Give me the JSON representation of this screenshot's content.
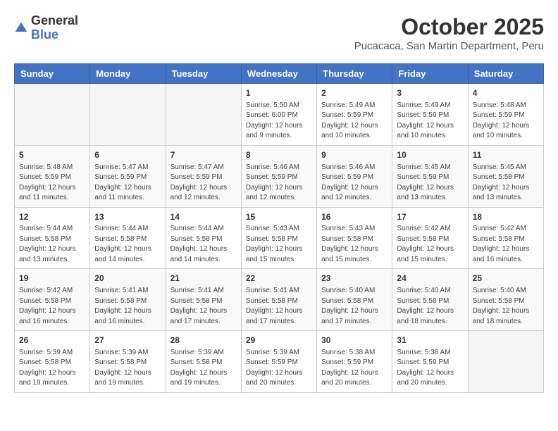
{
  "header": {
    "logo": {
      "general": "General",
      "blue": "Blue"
    },
    "title": "October 2025",
    "location": "Pucacaca, San Martin Department, Peru"
  },
  "calendar": {
    "days_of_week": [
      "Sunday",
      "Monday",
      "Tuesday",
      "Wednesday",
      "Thursday",
      "Friday",
      "Saturday"
    ],
    "weeks": [
      [
        {
          "day": "",
          "info": ""
        },
        {
          "day": "",
          "info": ""
        },
        {
          "day": "",
          "info": ""
        },
        {
          "day": "1",
          "info": "Sunrise: 5:50 AM\nSunset: 6:00 PM\nDaylight: 12 hours\nand 9 minutes."
        },
        {
          "day": "2",
          "info": "Sunrise: 5:49 AM\nSunset: 5:59 PM\nDaylight: 12 hours\nand 10 minutes."
        },
        {
          "day": "3",
          "info": "Sunrise: 5:49 AM\nSunset: 5:59 PM\nDaylight: 12 hours\nand 10 minutes."
        },
        {
          "day": "4",
          "info": "Sunrise: 5:48 AM\nSunset: 5:59 PM\nDaylight: 12 hours\nand 10 minutes."
        }
      ],
      [
        {
          "day": "5",
          "info": "Sunrise: 5:48 AM\nSunset: 5:59 PM\nDaylight: 12 hours\nand 11 minutes."
        },
        {
          "day": "6",
          "info": "Sunrise: 5:47 AM\nSunset: 5:59 PM\nDaylight: 12 hours\nand 11 minutes."
        },
        {
          "day": "7",
          "info": "Sunrise: 5:47 AM\nSunset: 5:59 PM\nDaylight: 12 hours\nand 12 minutes."
        },
        {
          "day": "8",
          "info": "Sunrise: 5:46 AM\nSunset: 5:59 PM\nDaylight: 12 hours\nand 12 minutes."
        },
        {
          "day": "9",
          "info": "Sunrise: 5:46 AM\nSunset: 5:59 PM\nDaylight: 12 hours\nand 12 minutes."
        },
        {
          "day": "10",
          "info": "Sunrise: 5:45 AM\nSunset: 5:59 PM\nDaylight: 12 hours\nand 13 minutes."
        },
        {
          "day": "11",
          "info": "Sunrise: 5:45 AM\nSunset: 5:58 PM\nDaylight: 12 hours\nand 13 minutes."
        }
      ],
      [
        {
          "day": "12",
          "info": "Sunrise: 5:44 AM\nSunset: 5:58 PM\nDaylight: 12 hours\nand 13 minutes."
        },
        {
          "day": "13",
          "info": "Sunrise: 5:44 AM\nSunset: 5:58 PM\nDaylight: 12 hours\nand 14 minutes."
        },
        {
          "day": "14",
          "info": "Sunrise: 5:44 AM\nSunset: 5:58 PM\nDaylight: 12 hours\nand 14 minutes."
        },
        {
          "day": "15",
          "info": "Sunrise: 5:43 AM\nSunset: 5:58 PM\nDaylight: 12 hours\nand 15 minutes."
        },
        {
          "day": "16",
          "info": "Sunrise: 5:43 AM\nSunset: 5:58 PM\nDaylight: 12 hours\nand 15 minutes."
        },
        {
          "day": "17",
          "info": "Sunrise: 5:42 AM\nSunset: 5:58 PM\nDaylight: 12 hours\nand 15 minutes."
        },
        {
          "day": "18",
          "info": "Sunrise: 5:42 AM\nSunset: 5:58 PM\nDaylight: 12 hours\nand 16 minutes."
        }
      ],
      [
        {
          "day": "19",
          "info": "Sunrise: 5:42 AM\nSunset: 5:58 PM\nDaylight: 12 hours\nand 16 minutes."
        },
        {
          "day": "20",
          "info": "Sunrise: 5:41 AM\nSunset: 5:58 PM\nDaylight: 12 hours\nand 16 minutes."
        },
        {
          "day": "21",
          "info": "Sunrise: 5:41 AM\nSunset: 5:58 PM\nDaylight: 12 hours\nand 17 minutes."
        },
        {
          "day": "22",
          "info": "Sunrise: 5:41 AM\nSunset: 5:58 PM\nDaylight: 12 hours\nand 17 minutes."
        },
        {
          "day": "23",
          "info": "Sunrise: 5:40 AM\nSunset: 5:58 PM\nDaylight: 12 hours\nand 17 minutes."
        },
        {
          "day": "24",
          "info": "Sunrise: 5:40 AM\nSunset: 5:58 PM\nDaylight: 12 hours\nand 18 minutes."
        },
        {
          "day": "25",
          "info": "Sunrise: 5:40 AM\nSunset: 5:58 PM\nDaylight: 12 hours\nand 18 minutes."
        }
      ],
      [
        {
          "day": "26",
          "info": "Sunrise: 5:39 AM\nSunset: 5:58 PM\nDaylight: 12 hours\nand 19 minutes."
        },
        {
          "day": "27",
          "info": "Sunrise: 5:39 AM\nSunset: 5:58 PM\nDaylight: 12 hours\nand 19 minutes."
        },
        {
          "day": "28",
          "info": "Sunrise: 5:39 AM\nSunset: 5:58 PM\nDaylight: 12 hours\nand 19 minutes."
        },
        {
          "day": "29",
          "info": "Sunrise: 5:39 AM\nSunset: 5:59 PM\nDaylight: 12 hours\nand 20 minutes."
        },
        {
          "day": "30",
          "info": "Sunrise: 5:38 AM\nSunset: 5:59 PM\nDaylight: 12 hours\nand 20 minutes."
        },
        {
          "day": "31",
          "info": "Sunrise: 5:38 AM\nSunset: 5:59 PM\nDaylight: 12 hours\nand 20 minutes."
        },
        {
          "day": "",
          "info": ""
        }
      ]
    ]
  }
}
